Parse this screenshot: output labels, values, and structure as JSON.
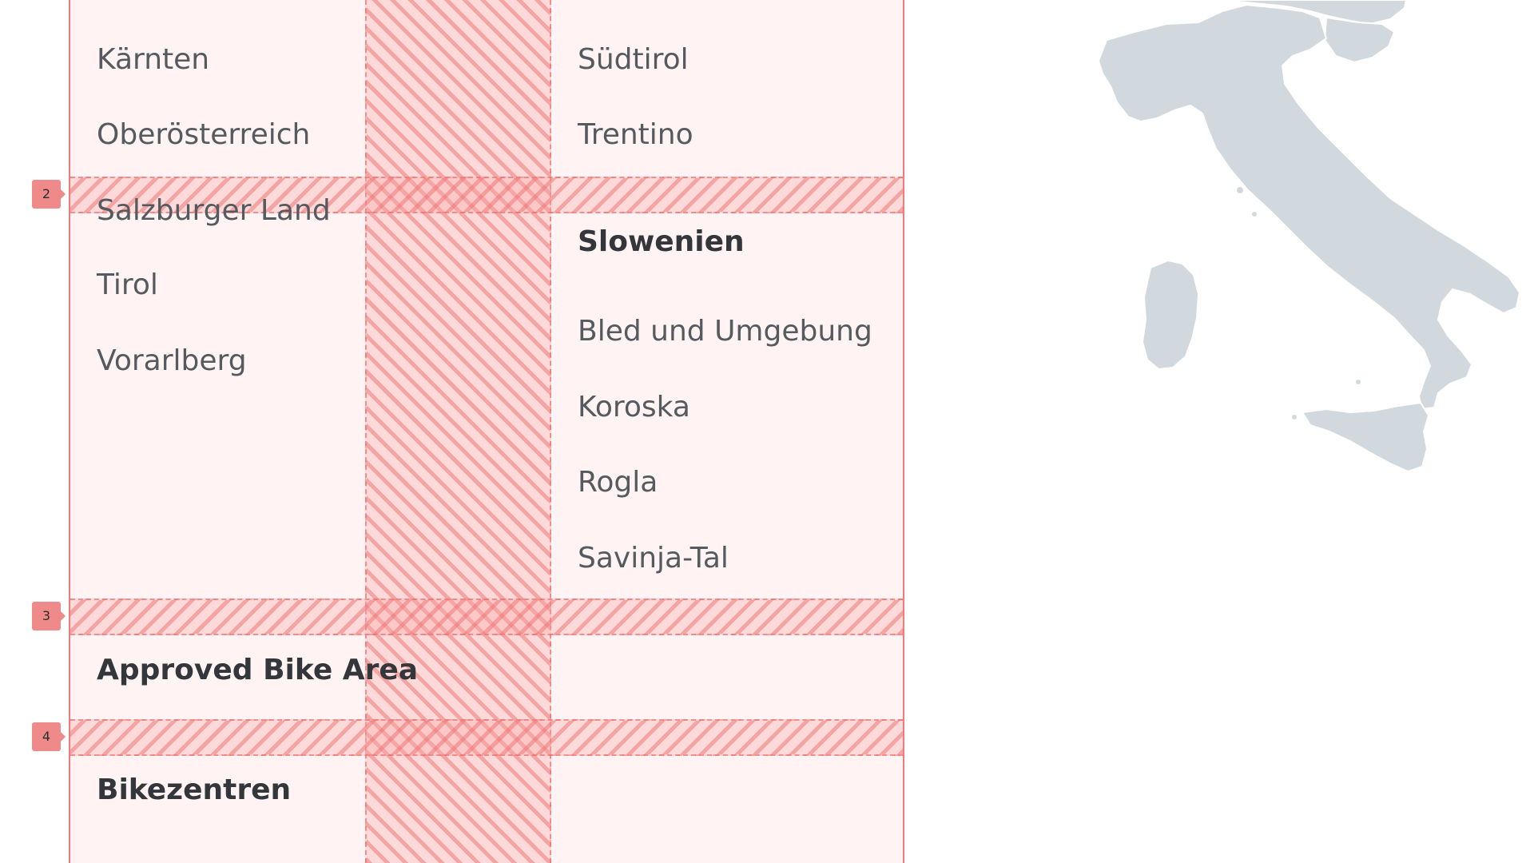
{
  "austria_regions": [
    "Kärnten",
    "Oberösterreich",
    "Salzburger Land",
    "Tirol",
    "Vorarlberg"
  ],
  "italy_regions": [
    "Südtirol",
    "Trentino"
  ],
  "slovenia": {
    "heading": "Slowenien",
    "regions": [
      "Bled und Umgebung",
      "Koroska",
      "Rogla",
      "Savinja-Tal"
    ]
  },
  "approved_bike_area": "Approved Bike Area",
  "bikezentren": "Bikezentren",
  "grid_row_markers": [
    "2",
    "3",
    "4"
  ],
  "colors": {
    "grid_overlay": "#ef7c7c",
    "grid_fill": "#fff4f3",
    "map_fill": "#d2d9de",
    "text_regular": "#555a5f",
    "text_heading": "#33373b"
  }
}
